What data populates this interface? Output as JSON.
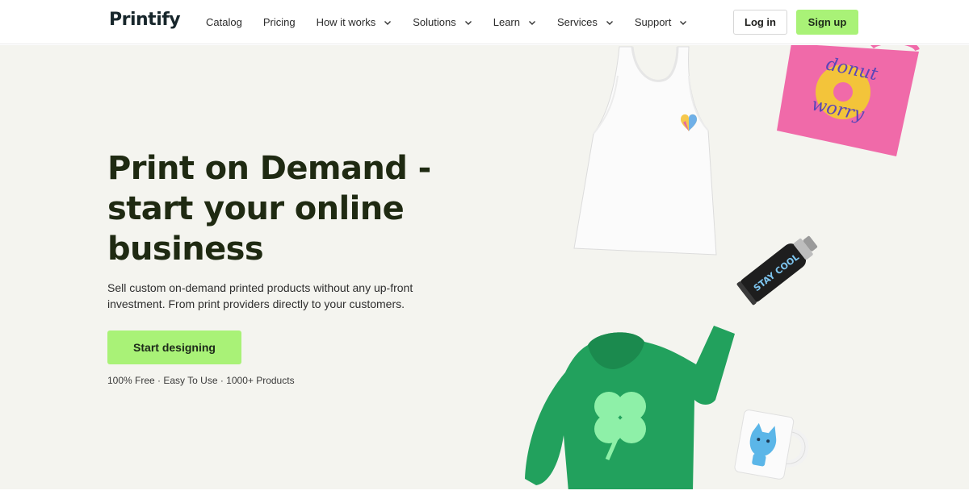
{
  "brand": {
    "logo_text": "Printify"
  },
  "nav": {
    "items": [
      {
        "label": "Catalog",
        "has_dropdown": false
      },
      {
        "label": "Pricing",
        "has_dropdown": false
      },
      {
        "label": "How it works",
        "has_dropdown": true
      },
      {
        "label": "Solutions",
        "has_dropdown": true
      },
      {
        "label": "Learn",
        "has_dropdown": true
      },
      {
        "label": "Services",
        "has_dropdown": true
      },
      {
        "label": "Support",
        "has_dropdown": true
      }
    ],
    "login_label": "Log in",
    "signup_label": "Sign up"
  },
  "hero": {
    "title_line1": "Print on Demand -",
    "title_line2": "start your online",
    "title_line3": "business",
    "subtitle": "Sell custom on-demand printed products without any up-front investment. From print providers directly to your customers.",
    "cta_label": "Start designing",
    "tagline": "100% Free · Easy To Use · 1000+ Products"
  },
  "products": {
    "tote_text_line1": "donut",
    "tote_text_line2": "worry",
    "bottle_text": "STAY COOL"
  },
  "colors": {
    "accent_green": "#a9f277",
    "hero_background": "#f4f4ef",
    "title_color": "#1f2a12",
    "hoodie_green": "#22a15d",
    "tote_pink": "#f06aa9"
  }
}
